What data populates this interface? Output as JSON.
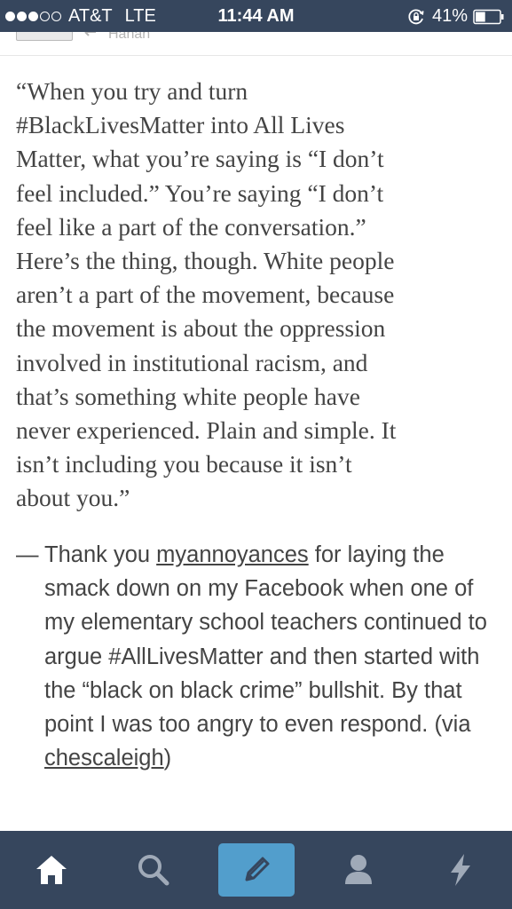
{
  "status_bar": {
    "carrier": "AT&T",
    "network": "LTE",
    "time": "11:44 AM",
    "battery_percent": "41%",
    "battery_level": 0.41,
    "signal_bars_filled": 3,
    "signal_bars_total": 5
  },
  "post_header": {
    "author_name": "Hánah"
  },
  "post": {
    "quote_lines": [
      "“When you try and turn",
      "#BlackLivesMatter into All Lives",
      "Matter, what you’re saying is “I don’t",
      "feel included.” You’re saying “I don’t",
      "feel like a part of the conversation.”",
      "Here’s the thing, though. White people",
      "aren’t a part of the movement, because",
      "the movement is about the oppression",
      "involved in institutional racism, and",
      "that’s something white people have",
      "never experienced. Plain and simple. It",
      "isn’t including you because it isn’t",
      "about you.”"
    ],
    "attribution": {
      "dash": "—",
      "intro": "Thank you ",
      "user_1": "myannoyances",
      "middle": " for laying the smack down on my Facebook when one of my elementary school teachers continued to argue #AllLivesMatter and then started with the “black on black crime” bullshit. By that point I was too angry to even respond. (via ",
      "user_2": "chescaleigh",
      "end": ")"
    }
  },
  "tab_bar": {
    "tabs": [
      {
        "name": "home",
        "icon": "home-icon"
      },
      {
        "name": "search",
        "icon": "search-icon"
      },
      {
        "name": "compose",
        "icon": "pencil-icon"
      },
      {
        "name": "account",
        "icon": "person-icon"
      },
      {
        "name": "activity",
        "icon": "lightning-icon"
      }
    ]
  },
  "colors": {
    "bar_bg": "#36465d",
    "compose_accent": "#529ecc",
    "text": "#444444",
    "inactive_icon": "#a0aab8"
  }
}
